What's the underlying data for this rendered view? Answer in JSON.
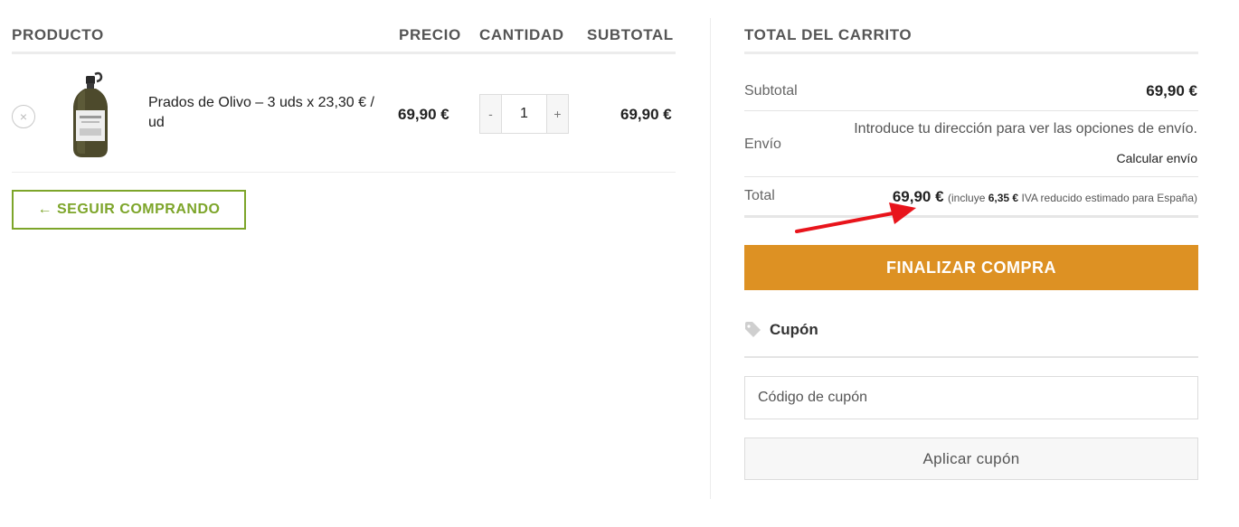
{
  "table": {
    "headers": {
      "product": "PRODUCTO",
      "price": "PRECIO",
      "quantity": "CANTIDAD",
      "subtotal": "SUBTOTAL"
    },
    "items": [
      {
        "remove_icon": "×",
        "name": "Prados de Olivo – 3 uds x 23,30 € / ud",
        "price": "69,90 €",
        "qty_minus": "-",
        "quantity": "1",
        "qty_plus": "+",
        "subtotal": "69,90 €",
        "thumb_icon": "olive-oil-bottle-icon"
      }
    ]
  },
  "continue_button": "← SEGUIR COMPRANDO",
  "totals": {
    "title": "TOTAL DEL CARRITO",
    "subtotal_label": "Subtotal",
    "subtotal_value": "69,90 €",
    "shipping_label": "Envío",
    "shipping_message": "Introduce tu dirección para ver las opciones de envío.",
    "calculate_shipping": "Calcular envío",
    "total_label": "Total",
    "total_value": "69,90 €",
    "tax_note_prefix": "(incluye",
    "tax_amount": "6,35 €",
    "tax_note_suffix": "IVA reducido estimado para España)"
  },
  "checkout_button": "FINALIZAR COMPRA",
  "coupon": {
    "heading": "Cupón",
    "icon": "tag-icon",
    "placeholder": "Código de cupón",
    "apply_button": "Aplicar cupón"
  },
  "annotation": {
    "icon": "red-arrow-icon",
    "color": "#e8141b"
  },
  "colors": {
    "accent_green": "#7da52a",
    "checkout_orange": "#dd9123"
  }
}
